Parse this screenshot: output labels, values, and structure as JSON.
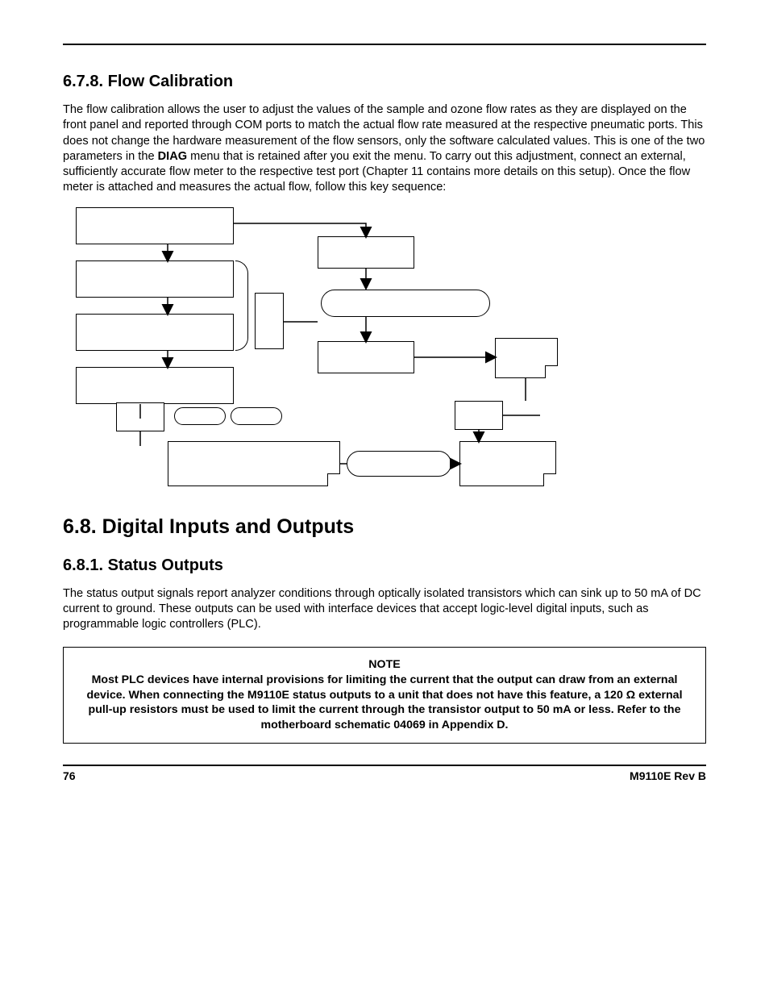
{
  "sections": {
    "s678": {
      "title": "6.7.8. Flow Calibration",
      "para_a": "The flow calibration allows the user to adjust the values of the sample and ozone flow rates as they are displayed on the front panel and reported through COM ports to match the actual flow rate measured at the respective pneumatic ports. This does not change the hardware measurement of the flow sensors, only the software calculated values. This is one of the two parameters in the ",
      "bold1": "DIAG",
      "para_b": " menu that is retained after you exit the menu. To carry out this adjustment, connect an external, sufficiently accurate flow meter to the respective test port (Chapter 11 contains more details on this setup). Once the flow meter is attached and measures the actual flow, follow this key sequence:"
    },
    "s68": {
      "title": "6.8. Digital Inputs and Outputs"
    },
    "s681": {
      "title": "6.8.1. Status Outputs",
      "para": "The status output signals report analyzer conditions through optically isolated transistors which can sink up to 50 mA of DC current to ground. These outputs can be used with interface devices that accept logic-level digital inputs, such as programmable logic controllers (PLC)."
    },
    "note": {
      "title": "NOTE",
      "body": "Most PLC devices have internal provisions for limiting the current that the output can draw from an external device. When connecting the M9110E status outputs to a unit that does not have this feature, a 120 Ω external pull-up resistors must be used to limit the current through the transistor output to 50 mA or less. Refer to the motherboard schematic 04069 in Appendix D."
    }
  },
  "footer": {
    "page": "76",
    "doc": "M9110E Rev B"
  }
}
